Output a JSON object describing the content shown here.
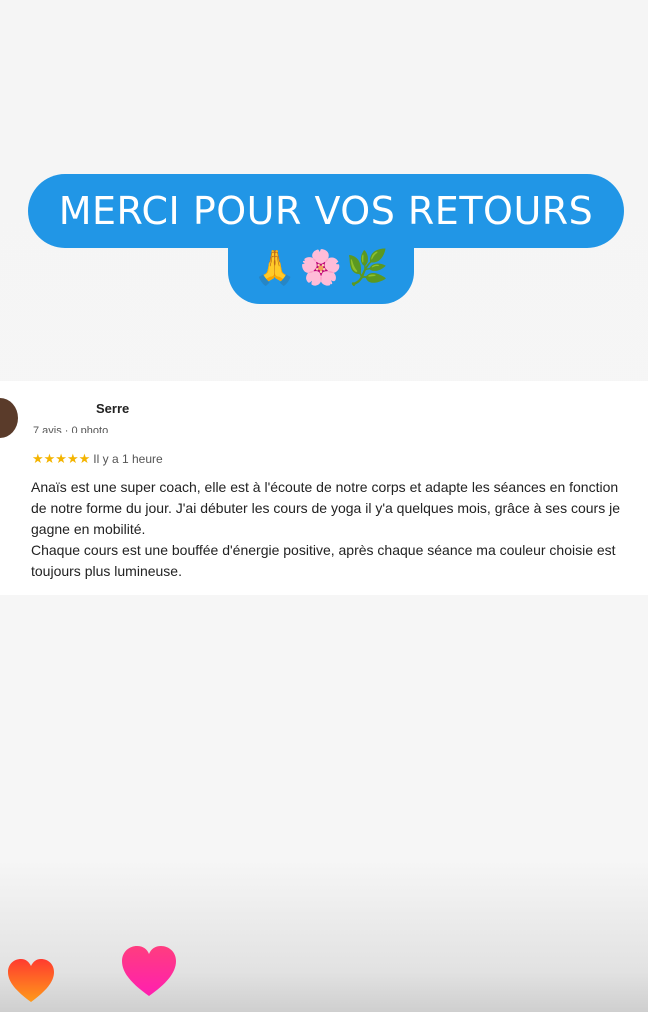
{
  "banner": {
    "title": "MERCI POUR VOS RETOURS",
    "emojis": [
      "🙏",
      "🌸",
      "🌿"
    ]
  },
  "review": {
    "reviewer_name": "Serre",
    "reviewer_meta": "7 avis · 0 photo",
    "stars": "★★★★★",
    "rating": 5,
    "time_ago": "Il y a 1 heure",
    "paragraph1": "Anaïs est une super coach, elle est à l'écoute de notre corps et adapte les séances en fonction de notre forme du jour. J'ai débuter les cours de yoga il y'a quelques mois, grâce à ses cours je gagne en mobilité.",
    "paragraph2": "Chaque cours est une bouffée d'énergie positive, après chaque séance ma couleur choisie est toujours plus lumineuse."
  },
  "reactions": {
    "heart_left": "orange-heart-icon",
    "heart_right": "pink-heart-icon",
    "colors": {
      "orange": "#ff5a1f",
      "pink": "#ff2d8a"
    }
  },
  "colors": {
    "banner": "#2196e6",
    "stars": "#f4b400"
  }
}
